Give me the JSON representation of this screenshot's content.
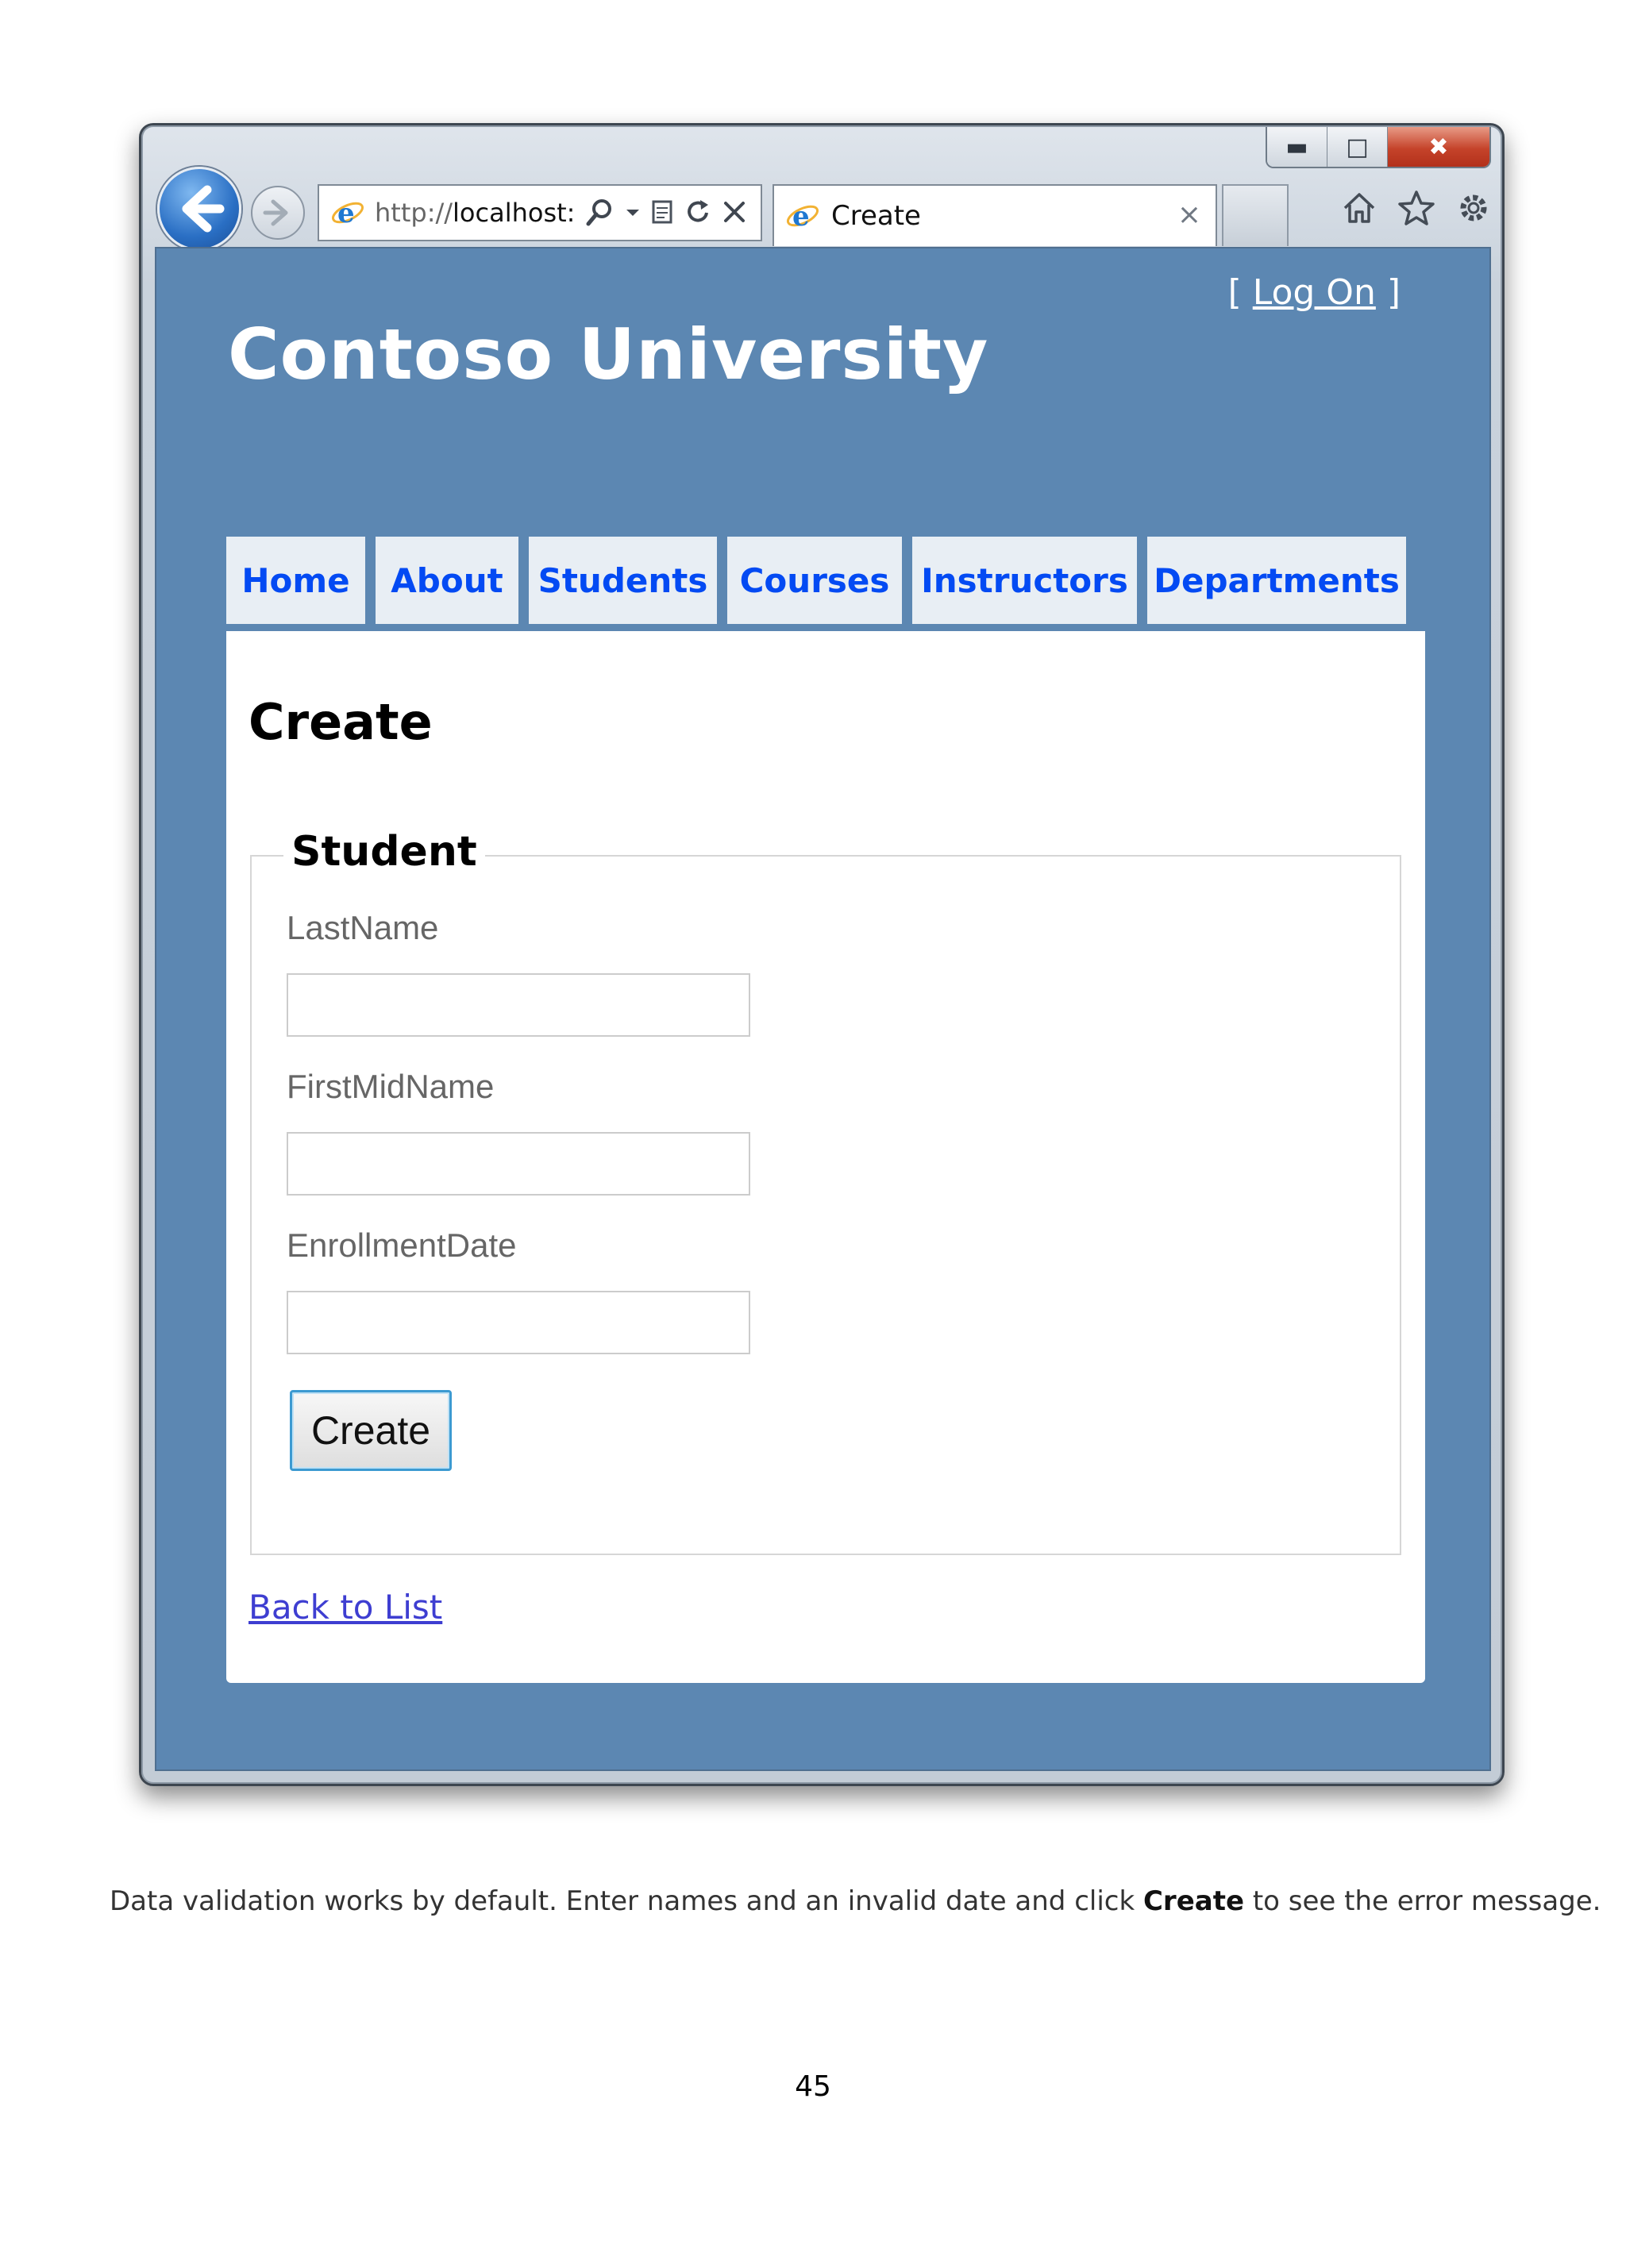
{
  "browser": {
    "url_prefix": "http://",
    "url_host": "localhost:",
    "tab_title": "Create",
    "tab_close": "×"
  },
  "site": {
    "login_open": "[ ",
    "login_link": "Log On",
    "login_close": " ]",
    "title": "Contoso University"
  },
  "menu": {
    "items": [
      {
        "label": "Home"
      },
      {
        "label": "About"
      },
      {
        "label": "Students"
      },
      {
        "label": "Courses"
      },
      {
        "label": "Instructors"
      },
      {
        "label": "Departments"
      }
    ]
  },
  "form": {
    "page_title": "Create",
    "legend": "Student",
    "fields": [
      {
        "label": "LastName",
        "value": ""
      },
      {
        "label": "FirstMidName",
        "value": ""
      },
      {
        "label": "EnrollmentDate",
        "value": ""
      }
    ],
    "submit_label": "Create",
    "back_link": "Back to List"
  },
  "document": {
    "caption_before": "Data validation works by default. Enter names and an invalid date and click ",
    "caption_bold": "Create",
    "caption_after": " to see the error message.",
    "page_number": "45"
  },
  "colors": {
    "page_background": "#5c87b2",
    "menu_link": "#034af3",
    "menu_tab": "#e8eef4"
  }
}
